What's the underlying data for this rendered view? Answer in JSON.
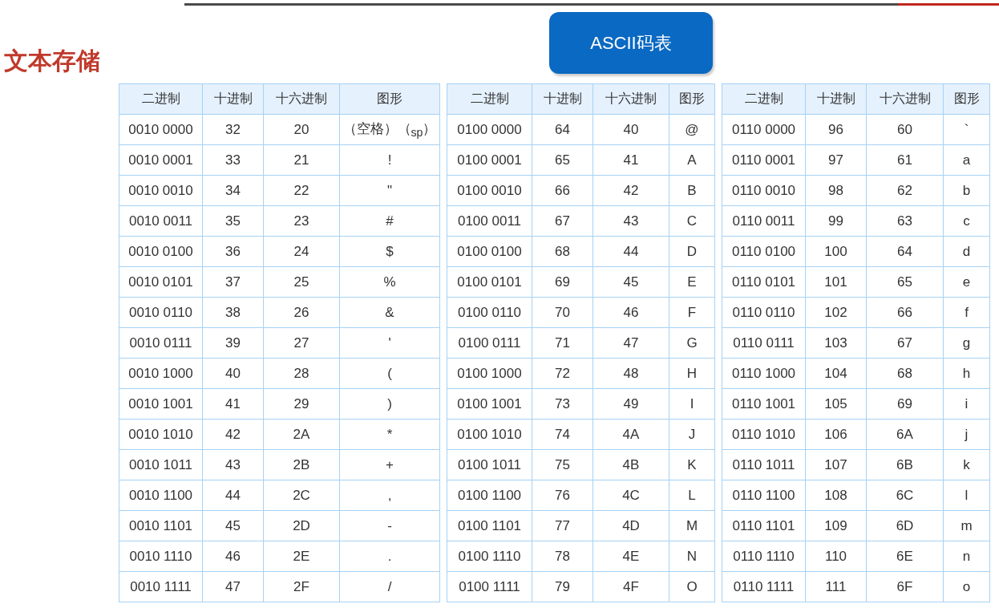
{
  "title": "文本存储",
  "button": "ASCII码表",
  "tables": [
    {
      "columns": [
        "二进制",
        "十进制",
        "十六进制",
        "图形"
      ],
      "rows": [
        [
          "0010 0000",
          "32",
          "20",
          "（空格）（$_{sp}$）"
        ],
        [
          "0010 0001",
          "33",
          "21",
          "!"
        ],
        [
          "0010 0010",
          "34",
          "22",
          "\""
        ],
        [
          "0010 0011",
          "35",
          "23",
          "#"
        ],
        [
          "0010 0100",
          "36",
          "24",
          "$"
        ],
        [
          "0010 0101",
          "37",
          "25",
          "%"
        ],
        [
          "0010 0110",
          "38",
          "26",
          "&"
        ],
        [
          "0010 0111",
          "39",
          "27",
          "'"
        ],
        [
          "0010 1000",
          "40",
          "28",
          "("
        ],
        [
          "0010 1001",
          "41",
          "29",
          ")"
        ],
        [
          "0010 1010",
          "42",
          "2A",
          "*"
        ],
        [
          "0010 1011",
          "43",
          "2B",
          "+"
        ],
        [
          "0010 1100",
          "44",
          "2C",
          ","
        ],
        [
          "0010 1101",
          "45",
          "2D",
          "-"
        ],
        [
          "0010 1110",
          "46",
          "2E",
          "."
        ],
        [
          "0010 1111",
          "47",
          "2F",
          "/"
        ]
      ]
    },
    {
      "columns": [
        "二进制",
        "十进制",
        "十六进制",
        "图形"
      ],
      "rows": [
        [
          "0100 0000",
          "64",
          "40",
          "@"
        ],
        [
          "0100 0001",
          "65",
          "41",
          "A"
        ],
        [
          "0100 0010",
          "66",
          "42",
          "B"
        ],
        [
          "0100 0011",
          "67",
          "43",
          "C"
        ],
        [
          "0100 0100",
          "68",
          "44",
          "D"
        ],
        [
          "0100 0101",
          "69",
          "45",
          "E"
        ],
        [
          "0100 0110",
          "70",
          "46",
          "F"
        ],
        [
          "0100 0111",
          "71",
          "47",
          "G"
        ],
        [
          "0100 1000",
          "72",
          "48",
          "H"
        ],
        [
          "0100 1001",
          "73",
          "49",
          "I"
        ],
        [
          "0100 1010",
          "74",
          "4A",
          "J"
        ],
        [
          "0100 1011",
          "75",
          "4B",
          "K"
        ],
        [
          "0100 1100",
          "76",
          "4C",
          "L"
        ],
        [
          "0100 1101",
          "77",
          "4D",
          "M"
        ],
        [
          "0100 1110",
          "78",
          "4E",
          "N"
        ],
        [
          "0100 1111",
          "79",
          "4F",
          "O"
        ]
      ]
    },
    {
      "columns": [
        "二进制",
        "十进制",
        "十六进制",
        "图形"
      ],
      "rows": [
        [
          "0110 0000",
          "96",
          "60",
          "`"
        ],
        [
          "0110 0001",
          "97",
          "61",
          "a"
        ],
        [
          "0110 0010",
          "98",
          "62",
          "b"
        ],
        [
          "0110 0011",
          "99",
          "63",
          "c"
        ],
        [
          "0110 0100",
          "100",
          "64",
          "d"
        ],
        [
          "0110 0101",
          "101",
          "65",
          "e"
        ],
        [
          "0110 0110",
          "102",
          "66",
          "f"
        ],
        [
          "0110 0111",
          "103",
          "67",
          "g"
        ],
        [
          "0110 1000",
          "104",
          "68",
          "h"
        ],
        [
          "0110 1001",
          "105",
          "69",
          "i"
        ],
        [
          "0110 1010",
          "106",
          "6A",
          "j"
        ],
        [
          "0110 1011",
          "107",
          "6B",
          "k"
        ],
        [
          "0110 1100",
          "108",
          "6C",
          "l"
        ],
        [
          "0110 1101",
          "109",
          "6D",
          "m"
        ],
        [
          "0110 1110",
          "110",
          "6E",
          "n"
        ],
        [
          "0110 1111",
          "111",
          "6F",
          "o"
        ]
      ]
    }
  ]
}
